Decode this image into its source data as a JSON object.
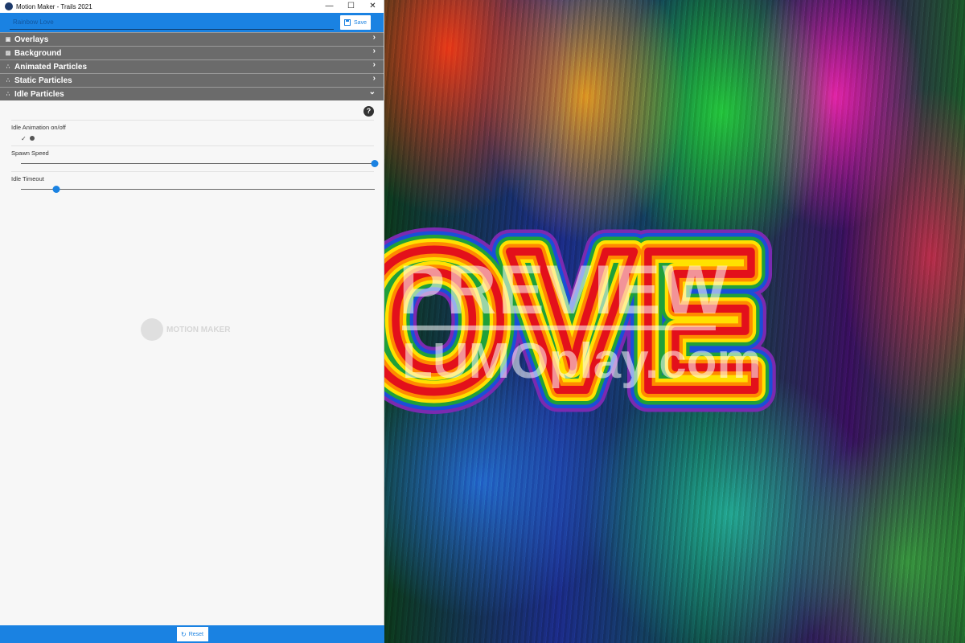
{
  "window": {
    "title": "Motion Maker - Trails 2021",
    "minimize": "—",
    "maximize": "☐",
    "close": "✕"
  },
  "savebar": {
    "name_value": "Rainbow Love",
    "save_label": "Save"
  },
  "sections": {
    "overlays": "Overlays",
    "background": "Background",
    "animated": "Animated Particles",
    "static": "Static Particles",
    "idle": "Idle Particles"
  },
  "idle": {
    "help": "?",
    "toggle_label": "Idle Animation on/off",
    "toggle_check": "✓",
    "toggle_value": true,
    "spawn_label": "Spawn Speed",
    "spawn_value": 1.0,
    "timeout_label": "Idle Timeout",
    "timeout_value": 0.1
  },
  "watermark_logo": "MOTION MAKER",
  "footer": {
    "reset_label": "Reset"
  },
  "preview": {
    "word": "OVE",
    "watermark_line1": "PREVIEW",
    "watermark_line2": "LUMOplay.com"
  },
  "colors": {
    "accent": "#1a82e2",
    "section_bg": "#6b6b6b",
    "rainbow": [
      "#e3101b",
      "#ff8a00",
      "#ffe100",
      "#1fa03a",
      "#1a4fd8",
      "#7b2ab0"
    ]
  }
}
